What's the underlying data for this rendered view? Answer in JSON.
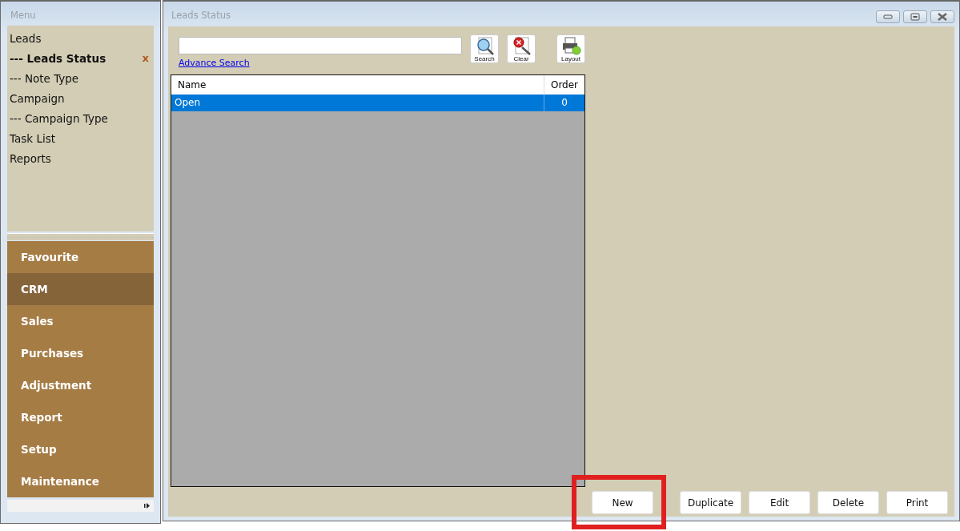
{
  "menu_panel": {
    "title": "Menu",
    "items": [
      {
        "label": "Leads",
        "selected": false,
        "closable": false
      },
      {
        "label": "--- Leads Status",
        "selected": true,
        "closable": true,
        "close_glyph": "x"
      },
      {
        "label": "--- Note Type",
        "selected": false,
        "closable": false
      },
      {
        "label": "Campaign",
        "selected": false,
        "closable": false
      },
      {
        "label": "--- Campaign Type",
        "selected": false,
        "closable": false
      },
      {
        "label": "Task List",
        "selected": false,
        "closable": false
      },
      {
        "label": "Reports",
        "selected": false,
        "closable": false
      }
    ],
    "modules": [
      {
        "label": "Favourite",
        "selected": false
      },
      {
        "label": "CRM",
        "selected": true
      },
      {
        "label": "Sales",
        "selected": false
      },
      {
        "label": "Purchases",
        "selected": false
      },
      {
        "label": "Adjustment",
        "selected": false
      },
      {
        "label": "Report",
        "selected": false
      },
      {
        "label": "Setup",
        "selected": false
      },
      {
        "label": "Maintenance",
        "selected": false
      }
    ]
  },
  "window": {
    "title": "Leads Status"
  },
  "search": {
    "link": "Advance Search",
    "tools": [
      {
        "kind": "search",
        "label": "Search"
      },
      {
        "kind": "clear",
        "label": "Clear"
      },
      {
        "kind": "layout",
        "label": "Layout"
      }
    ]
  },
  "table": {
    "columns": [
      "Name",
      "Order"
    ],
    "rows": [
      {
        "cells": [
          "Open",
          "0"
        ],
        "selected": true
      }
    ]
  },
  "buttons": [
    {
      "label": "New",
      "highlighted": true
    },
    {
      "label": "Duplicate",
      "highlighted": false
    },
    {
      "label": "Edit",
      "highlighted": false
    },
    {
      "label": "Delete",
      "highlighted": false
    },
    {
      "label": "Print",
      "highlighted": false
    }
  ]
}
